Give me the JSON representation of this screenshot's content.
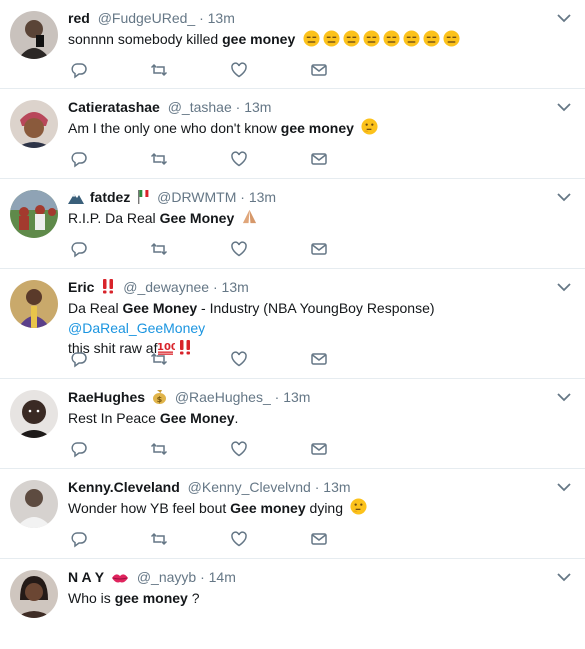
{
  "tweets": [
    {
      "name": "red",
      "handle": "@FudgeURed_",
      "sep": "·",
      "time": "13m",
      "text_before": "sonnnn somebody killed ",
      "bold": "gee money",
      "text_after": "",
      "emoji_count": 8,
      "name_emoji": "",
      "avatar_color": "#6b5a50"
    },
    {
      "name": "Catieratashae",
      "handle": "@_tashae",
      "sep": "·",
      "time": "13m",
      "text_before": "Am I the only one who don't know ",
      "bold": "gee money",
      "text_after": "",
      "trail_emoji": "thinking-face",
      "name_emoji": "",
      "avatar_color": "#b8475a"
    },
    {
      "name": "fatdez",
      "handle": "@DRWMTM",
      "sep": "·",
      "time": "13m",
      "text_before": "R.I.P. Da Real ",
      "bold": "Gee Money",
      "text_after": "",
      "trail_emoji": "folded-hands",
      "name_emoji": "mountain-flag",
      "avatar_color": "#a33a2e"
    },
    {
      "name": "Eric",
      "handle": "@_dewaynee",
      "sep": "·",
      "time": "13m",
      "text_before": "Da Real ",
      "bold": "Gee Money",
      "text_after": " - Industry (NBA YoungBoy Response) ",
      "link": "@DaReal_GeeMoney",
      "line2": "this shit raw af",
      "name_emoji": "double-exclamation",
      "avatar_color": "#3c3358"
    },
    {
      "name": "RaeHughes",
      "handle": "@RaeHughes_",
      "sep": "·",
      "time": "13m",
      "text_before": "Rest In Peace ",
      "bold": "Gee Money",
      "text_after": ".",
      "name_emoji": "money-bag",
      "avatar_color": "#2f2321"
    },
    {
      "name": "Kenny.Cleveland",
      "handle": "@Kenny_Clevelvnd",
      "sep": "·",
      "time": "13m",
      "text_before": "Wonder how YB feel bout ",
      "bold": "Gee money",
      "text_after": " dying ",
      "trail_emoji": "thinking-face",
      "name_emoji": "",
      "avatar_color": "#5d4b40"
    },
    {
      "name": "N A Y",
      "handle": "@_nayyb",
      "sep": "·",
      "time": "14m",
      "text_before": "Who is ",
      "bold": "gee money",
      "text_after": " ?",
      "name_emoji": "kiss-lips",
      "avatar_color": "#3e2c25"
    }
  ],
  "icons": {
    "reply": "reply-icon",
    "retweet": "retweet-icon",
    "like": "like-icon",
    "dm": "direct-message-icon",
    "caret": "chevron-down-icon"
  },
  "colors": {
    "name": "#14171a",
    "muted": "#657786",
    "link": "#1b95e0",
    "divider": "#e6ecf0"
  }
}
